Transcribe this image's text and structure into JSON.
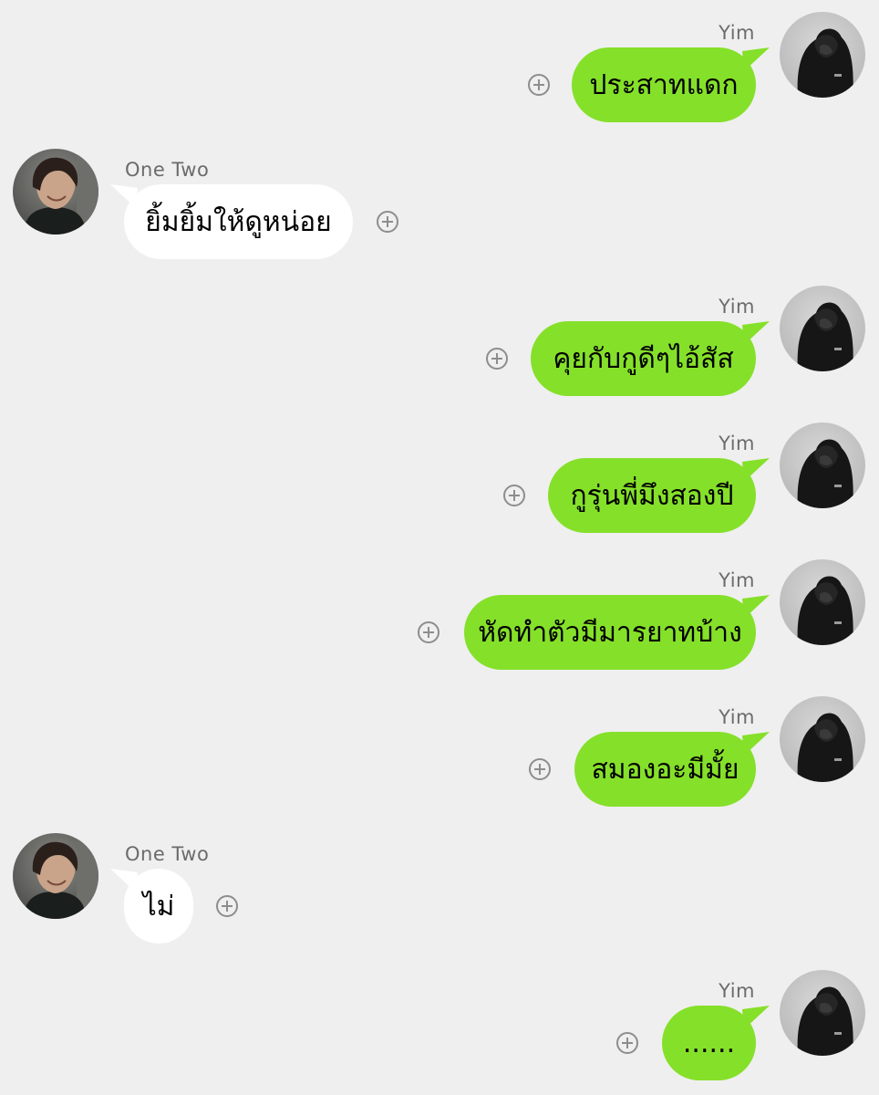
{
  "chat": {
    "messages": [
      {
        "sender": "Yim",
        "side": "right",
        "text": "ประสาทแดก"
      },
      {
        "sender": "One Two",
        "side": "left",
        "text": "ยิ้มยิ้มให้ดูหน่อย"
      },
      {
        "sender": "Yim",
        "side": "right",
        "text": "คุยกับกูดีๆไอ้สัส"
      },
      {
        "sender": "Yim",
        "side": "right",
        "text": "กูรุ่นพี่มึงสองปี"
      },
      {
        "sender": "Yim",
        "side": "right",
        "text": "หัดทำตัวมีมารยาทบ้าง"
      },
      {
        "sender": "Yim",
        "side": "right",
        "text": "สมองอะมีมั้ย"
      },
      {
        "sender": "One Two",
        "side": "left",
        "text": "ไม่"
      },
      {
        "sender": "Yim",
        "side": "right",
        "text": "......"
      }
    ]
  },
  "icons": {
    "react_button": "plus-circle-icon",
    "avatar_yim": "hooded-person-avatar",
    "avatar_onetwo": "smiling-person-avatar"
  },
  "colors": {
    "background": "#efefef",
    "outgoing_bubble": "#85e02a",
    "incoming_bubble": "#ffffff",
    "name_text": "#6b6b6b"
  }
}
